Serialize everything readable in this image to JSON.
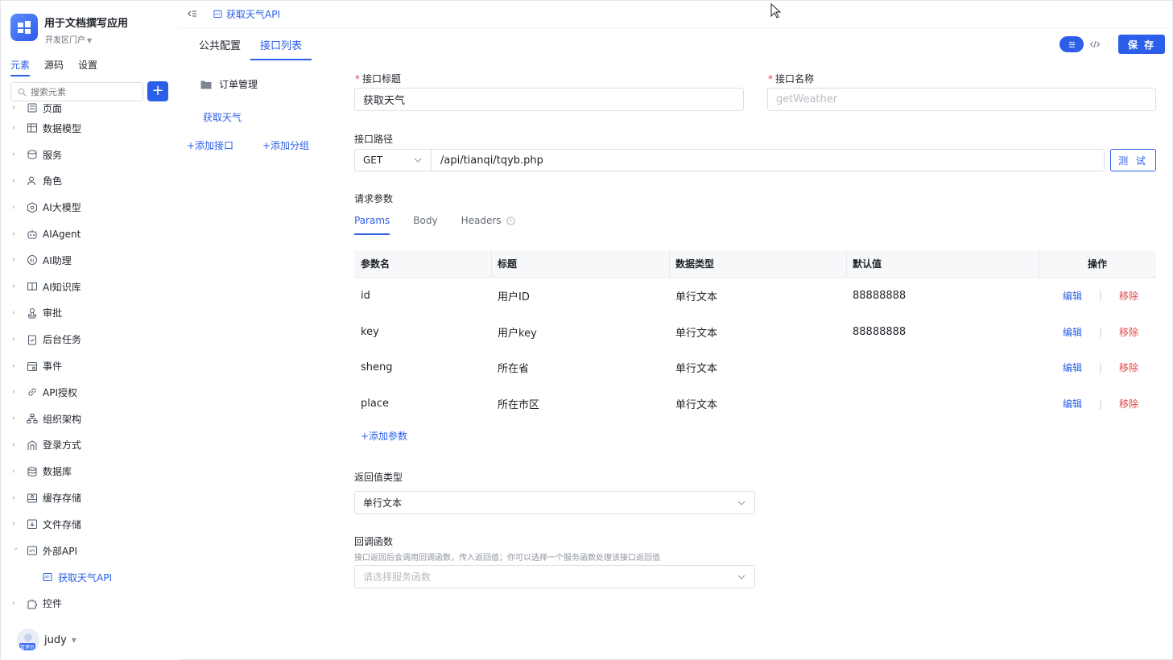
{
  "app": {
    "name": "用于文档撰写应用",
    "portal": "开发区门户"
  },
  "sidebar": {
    "tabs": [
      {
        "label": "元素",
        "active": true
      },
      {
        "label": "源码",
        "active": false
      },
      {
        "label": "设置",
        "active": false
      }
    ],
    "search_placeholder": "搜索元素",
    "add_label": "+",
    "items": [
      {
        "label": "页面",
        "icon": "page-icon"
      },
      {
        "label": "数据模型",
        "icon": "table-icon"
      },
      {
        "label": "服务",
        "icon": "service-icon"
      },
      {
        "label": "角色",
        "icon": "user-role-icon"
      },
      {
        "label": "AI大模型",
        "icon": "ai-model-icon"
      },
      {
        "label": "AIAgent",
        "icon": "robot-icon"
      },
      {
        "label": "AI助理",
        "icon": "ai-assistant-icon"
      },
      {
        "label": "AI知识库",
        "icon": "book-icon"
      },
      {
        "label": "审批",
        "icon": "stamp-icon"
      },
      {
        "label": "后台任务",
        "icon": "task-icon"
      },
      {
        "label": "事件",
        "icon": "event-icon"
      },
      {
        "label": "API授权",
        "icon": "link-icon"
      },
      {
        "label": "组织架构",
        "icon": "org-icon"
      },
      {
        "label": "登录方式",
        "icon": "login-icon"
      },
      {
        "label": "数据库",
        "icon": "database-icon"
      },
      {
        "label": "缓存存储",
        "icon": "cache-icon"
      },
      {
        "label": "文件存储",
        "icon": "file-storage-icon"
      },
      {
        "label": "外部API",
        "icon": "api-icon",
        "expanded": true
      }
    ],
    "child_item": "获取天气API",
    "last_item": {
      "label": "控件",
      "icon": "puzzle-icon"
    },
    "user": {
      "name": "judy",
      "badge": "管理员"
    }
  },
  "topbar": {
    "tab_title": "获取天气API"
  },
  "middle": {
    "tabs": [
      {
        "label": "公共配置",
        "active": false
      },
      {
        "label": "接口列表",
        "active": true
      }
    ],
    "folder": "订单管理",
    "api_item": "获取天气",
    "add_api": "+添加接口",
    "add_group": "+添加分组"
  },
  "toolbar": {
    "save_label": "保 存"
  },
  "form": {
    "title_label": "接口标题",
    "title_value": "获取天气",
    "name_label": "接口名称",
    "name_placeholder": "getWeather",
    "path_label": "接口路径",
    "method": "GET",
    "path": "/api/tianqi/tqyb.php",
    "test_label": "测 试",
    "params_label": "请求参数",
    "param_tabs": [
      {
        "label": "Params",
        "active": true
      },
      {
        "label": "Body",
        "active": false
      },
      {
        "label": "Headers",
        "active": false
      }
    ],
    "table": {
      "columns": [
        "参数名",
        "标题",
        "数据类型",
        "默认值",
        "操作"
      ],
      "rows": [
        {
          "name": "id",
          "title": "用户ID",
          "type": "单行文本",
          "default": "88888888"
        },
        {
          "name": "key",
          "title": "用户key",
          "type": "单行文本",
          "default": "88888888"
        },
        {
          "name": "sheng",
          "title": "所在省",
          "type": "单行文本",
          "default": ""
        },
        {
          "name": "place",
          "title": "所在市区",
          "type": "单行文本",
          "default": ""
        }
      ],
      "edit_label": "编辑",
      "remove_label": "移除",
      "separator": "|"
    },
    "add_param": "+添加参数",
    "return_label": "返回值类型",
    "return_value": "单行文本",
    "callback_label": "回调函数",
    "callback_hint": "接口返回后会调用回调函数，传入返回值；你可以选择一个服务函数处理该接口返回值",
    "callback_placeholder": "请选择服务函数"
  },
  "colors": {
    "accent": "#2b5fe9",
    "danger": "#e54545",
    "border": "#dcdfe6"
  }
}
